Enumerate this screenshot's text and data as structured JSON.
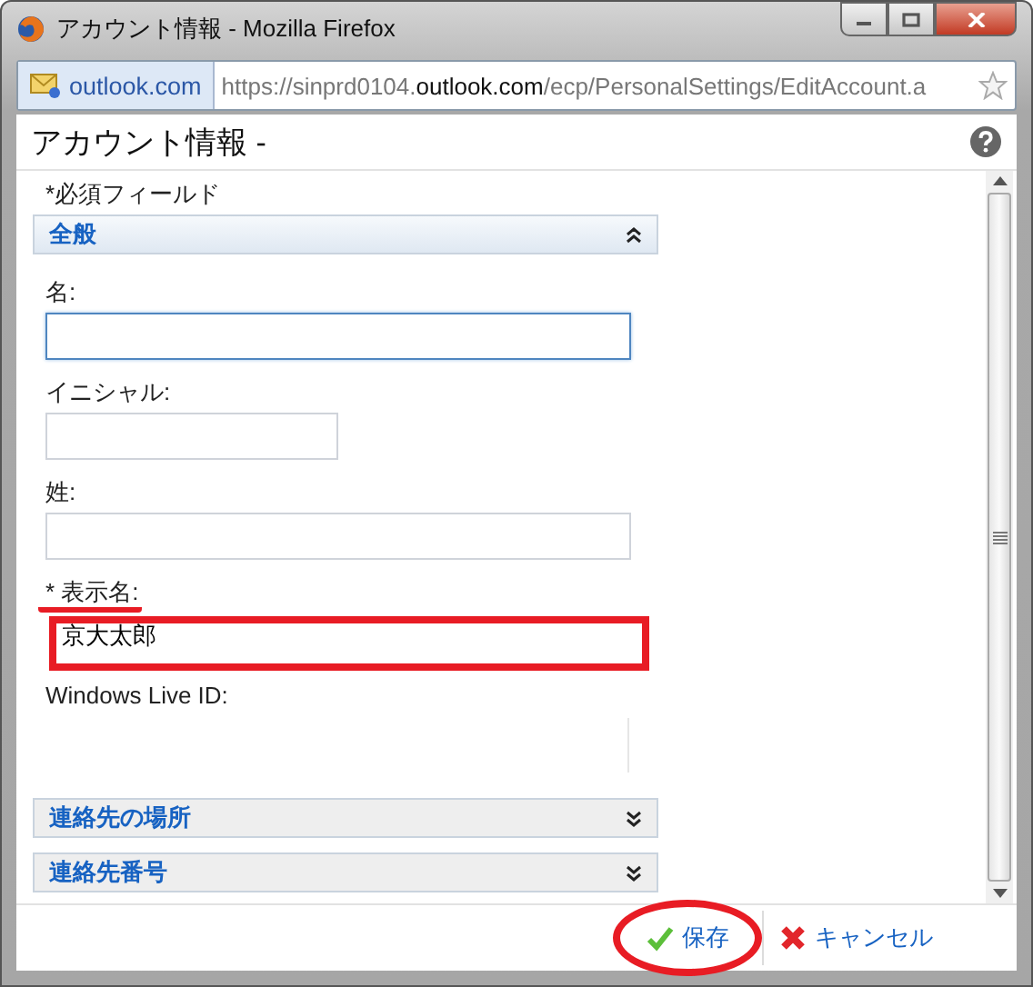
{
  "window": {
    "title": "アカウント情報 - Mozilla Firefox"
  },
  "address_bar": {
    "site": "outlook.com",
    "url": {
      "start": "https://sinprd0104.",
      "domain": "outlook.com",
      "path": "/ecp/PersonalSettings/EditAccount.a"
    }
  },
  "page": {
    "title": "アカウント情報 -",
    "required_note": "*必須フィールド"
  },
  "sections": [
    {
      "title": "全般",
      "expanded": true,
      "fields": [
        {
          "kind": "wide",
          "label": "名:",
          "focused": true
        },
        {
          "kind": "narrow",
          "label": "イニシャル:",
          "focused": false
        },
        {
          "kind": "wide",
          "label": "姓:",
          "focused": false
        },
        {
          "kind": "wide",
          "label": "* 表示名:",
          "value": "京大太郎",
          "focused": false,
          "underlined": true,
          "highlighted": true
        },
        {
          "kind": "readonly",
          "label": "Windows Live ID:"
        }
      ]
    },
    {
      "title": "連絡先の場所",
      "expanded": false
    },
    {
      "title": "連絡先番号",
      "expanded": false
    }
  ],
  "buttons": [
    {
      "kind": "save",
      "label": "保存",
      "circled": true
    },
    {
      "kind": "cancel",
      "label": "キャンセル",
      "circled": false
    }
  ]
}
